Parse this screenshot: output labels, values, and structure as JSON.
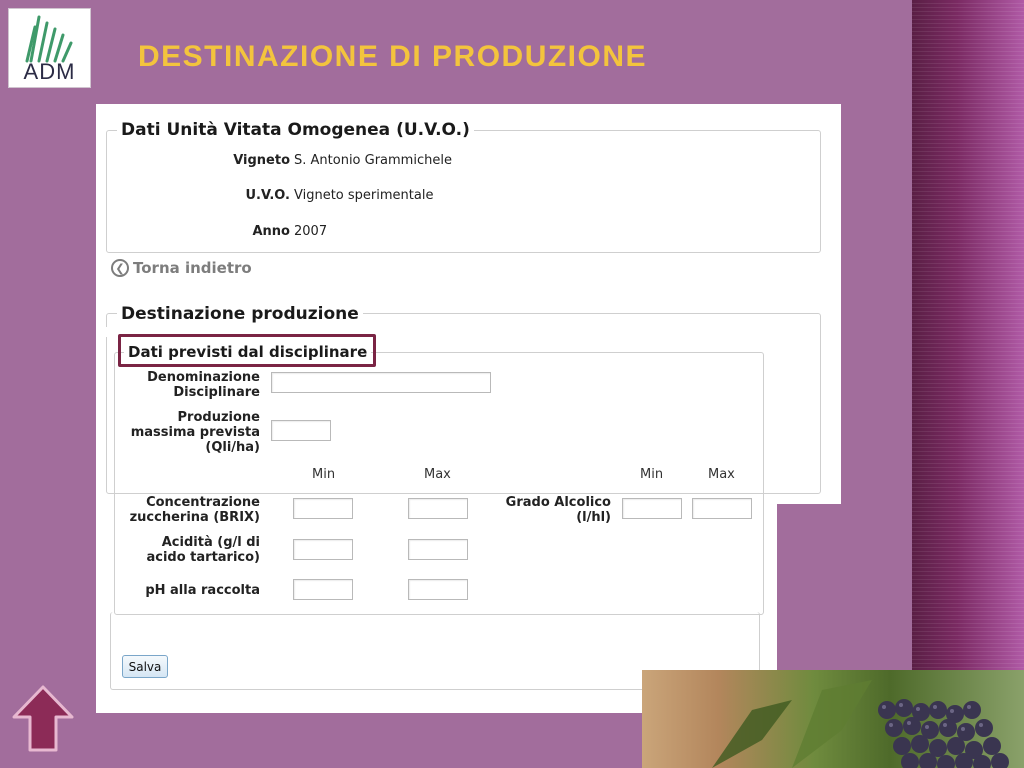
{
  "slide": {
    "title": "DESTINAZIONE DI PRODUZIONE",
    "logo_text": "ADM"
  },
  "uvo": {
    "legend": "Dati Unità Vitata Omogenea (U.V.O.)",
    "fields": [
      {
        "label": "Vigneto",
        "value": "S. Antonio Grammichele"
      },
      {
        "label": "U.V.O.",
        "value": "Vigneto sperimentale"
      },
      {
        "label": "Anno",
        "value": "2007"
      }
    ]
  },
  "back_link": {
    "label": "Torna indietro"
  },
  "production": {
    "legend": "Destinazione produzione",
    "disciplinare": {
      "legend": "Dati previsti dal disciplinare",
      "denominazione_label": "Denominazione Disciplinare",
      "denominazione_value": "",
      "produzione_label": "Produzione massima prevista (Qli/ha)",
      "produzione_value": "",
      "min_label": "Min",
      "max_label": "Max",
      "concentrazione_label": "Concentrazione zuccherina (BRIX)",
      "acidita_label": "Acidità (g/l di acido tartarico)",
      "ph_label": "pH alla raccolta",
      "grado_label": "Grado Alcolico (l/hl)"
    }
  },
  "actions": {
    "save_label": "Salva"
  },
  "colors": {
    "background": "#a26d9c",
    "title": "#f3c43d",
    "highlight_border": "#7a2444"
  }
}
